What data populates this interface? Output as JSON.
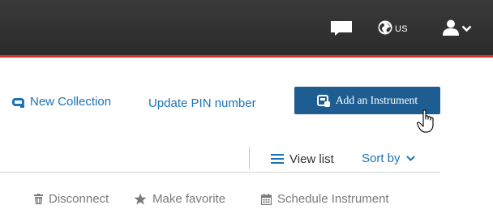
{
  "header": {
    "region_label": "US",
    "icons": [
      "chat-icon",
      "globe-icon",
      "user-icon",
      "chevron-down-icon"
    ],
    "colors": {
      "background": "#333333",
      "accent_line": "#d9322b"
    }
  },
  "actions": {
    "new_collection": "New Collection",
    "update_pin": "Update PIN number",
    "add_instrument": "Add an Instrument"
  },
  "view": {
    "view_list": "View list",
    "sort_by": "Sort by"
  },
  "toolbar": {
    "disconnect": "Disconnect",
    "make_favorite": "Make favorite",
    "schedule": "Schedule Instrument"
  },
  "colors": {
    "link": "#1a73b7",
    "button": "#1d5d91",
    "muted": "#7a7a7a"
  }
}
